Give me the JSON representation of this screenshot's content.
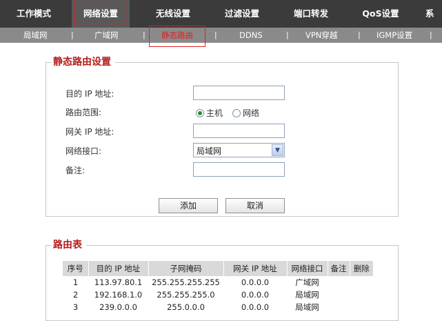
{
  "top_nav": {
    "tabs": [
      {
        "label": "工作模式"
      },
      {
        "label": "网络设置"
      },
      {
        "label": "无线设置"
      },
      {
        "label": "过滤设置"
      },
      {
        "label": "端口转发"
      },
      {
        "label": "QoS设置"
      },
      {
        "label": "系"
      }
    ]
  },
  "sub_nav": {
    "items": [
      {
        "label": "局域网"
      },
      {
        "label": "广域网"
      },
      {
        "label": "静态路由"
      },
      {
        "label": "DDNS"
      },
      {
        "label": "VPN穿越"
      },
      {
        "label": "IGMP设置"
      }
    ],
    "separator": "|"
  },
  "static_route": {
    "title": "静态路由设置",
    "dest_ip_label": "目的 IP 地址:",
    "dest_ip_value": "",
    "range_label": "路由范围:",
    "range_options": [
      "主机",
      "网络"
    ],
    "range_selected": "主机",
    "gateway_label": "网关 IP 地址:",
    "gateway_value": "",
    "interface_label": "网络接口:",
    "interface_value": "局域网",
    "remark_label": "备注:",
    "remark_value": "",
    "add_button": "添加",
    "cancel_button": "取消"
  },
  "route_table": {
    "title": "路由表",
    "headers": [
      "序号",
      "目的 IP 地址",
      "子网掩码",
      "网关 IP 地址",
      "网络接口",
      "备注",
      "删除"
    ],
    "rows": [
      [
        "1",
        "113.97.80.1",
        "255.255.255.255",
        "0.0.0.0",
        "广域网",
        "",
        ""
      ],
      [
        "2",
        "192.168.1.0",
        "255.255.255.0",
        "0.0.0.0",
        "局域网",
        "",
        ""
      ],
      [
        "3",
        "239.0.0.0",
        "255.0.0.0",
        "0.0.0.0",
        "局域网",
        "",
        ""
      ]
    ]
  },
  "colors": {
    "nav_bg": "#3b3b3b",
    "subnav_bg": "#8a8a8a",
    "accent_red": "#e02020",
    "legend_red": "#b71c1c"
  }
}
